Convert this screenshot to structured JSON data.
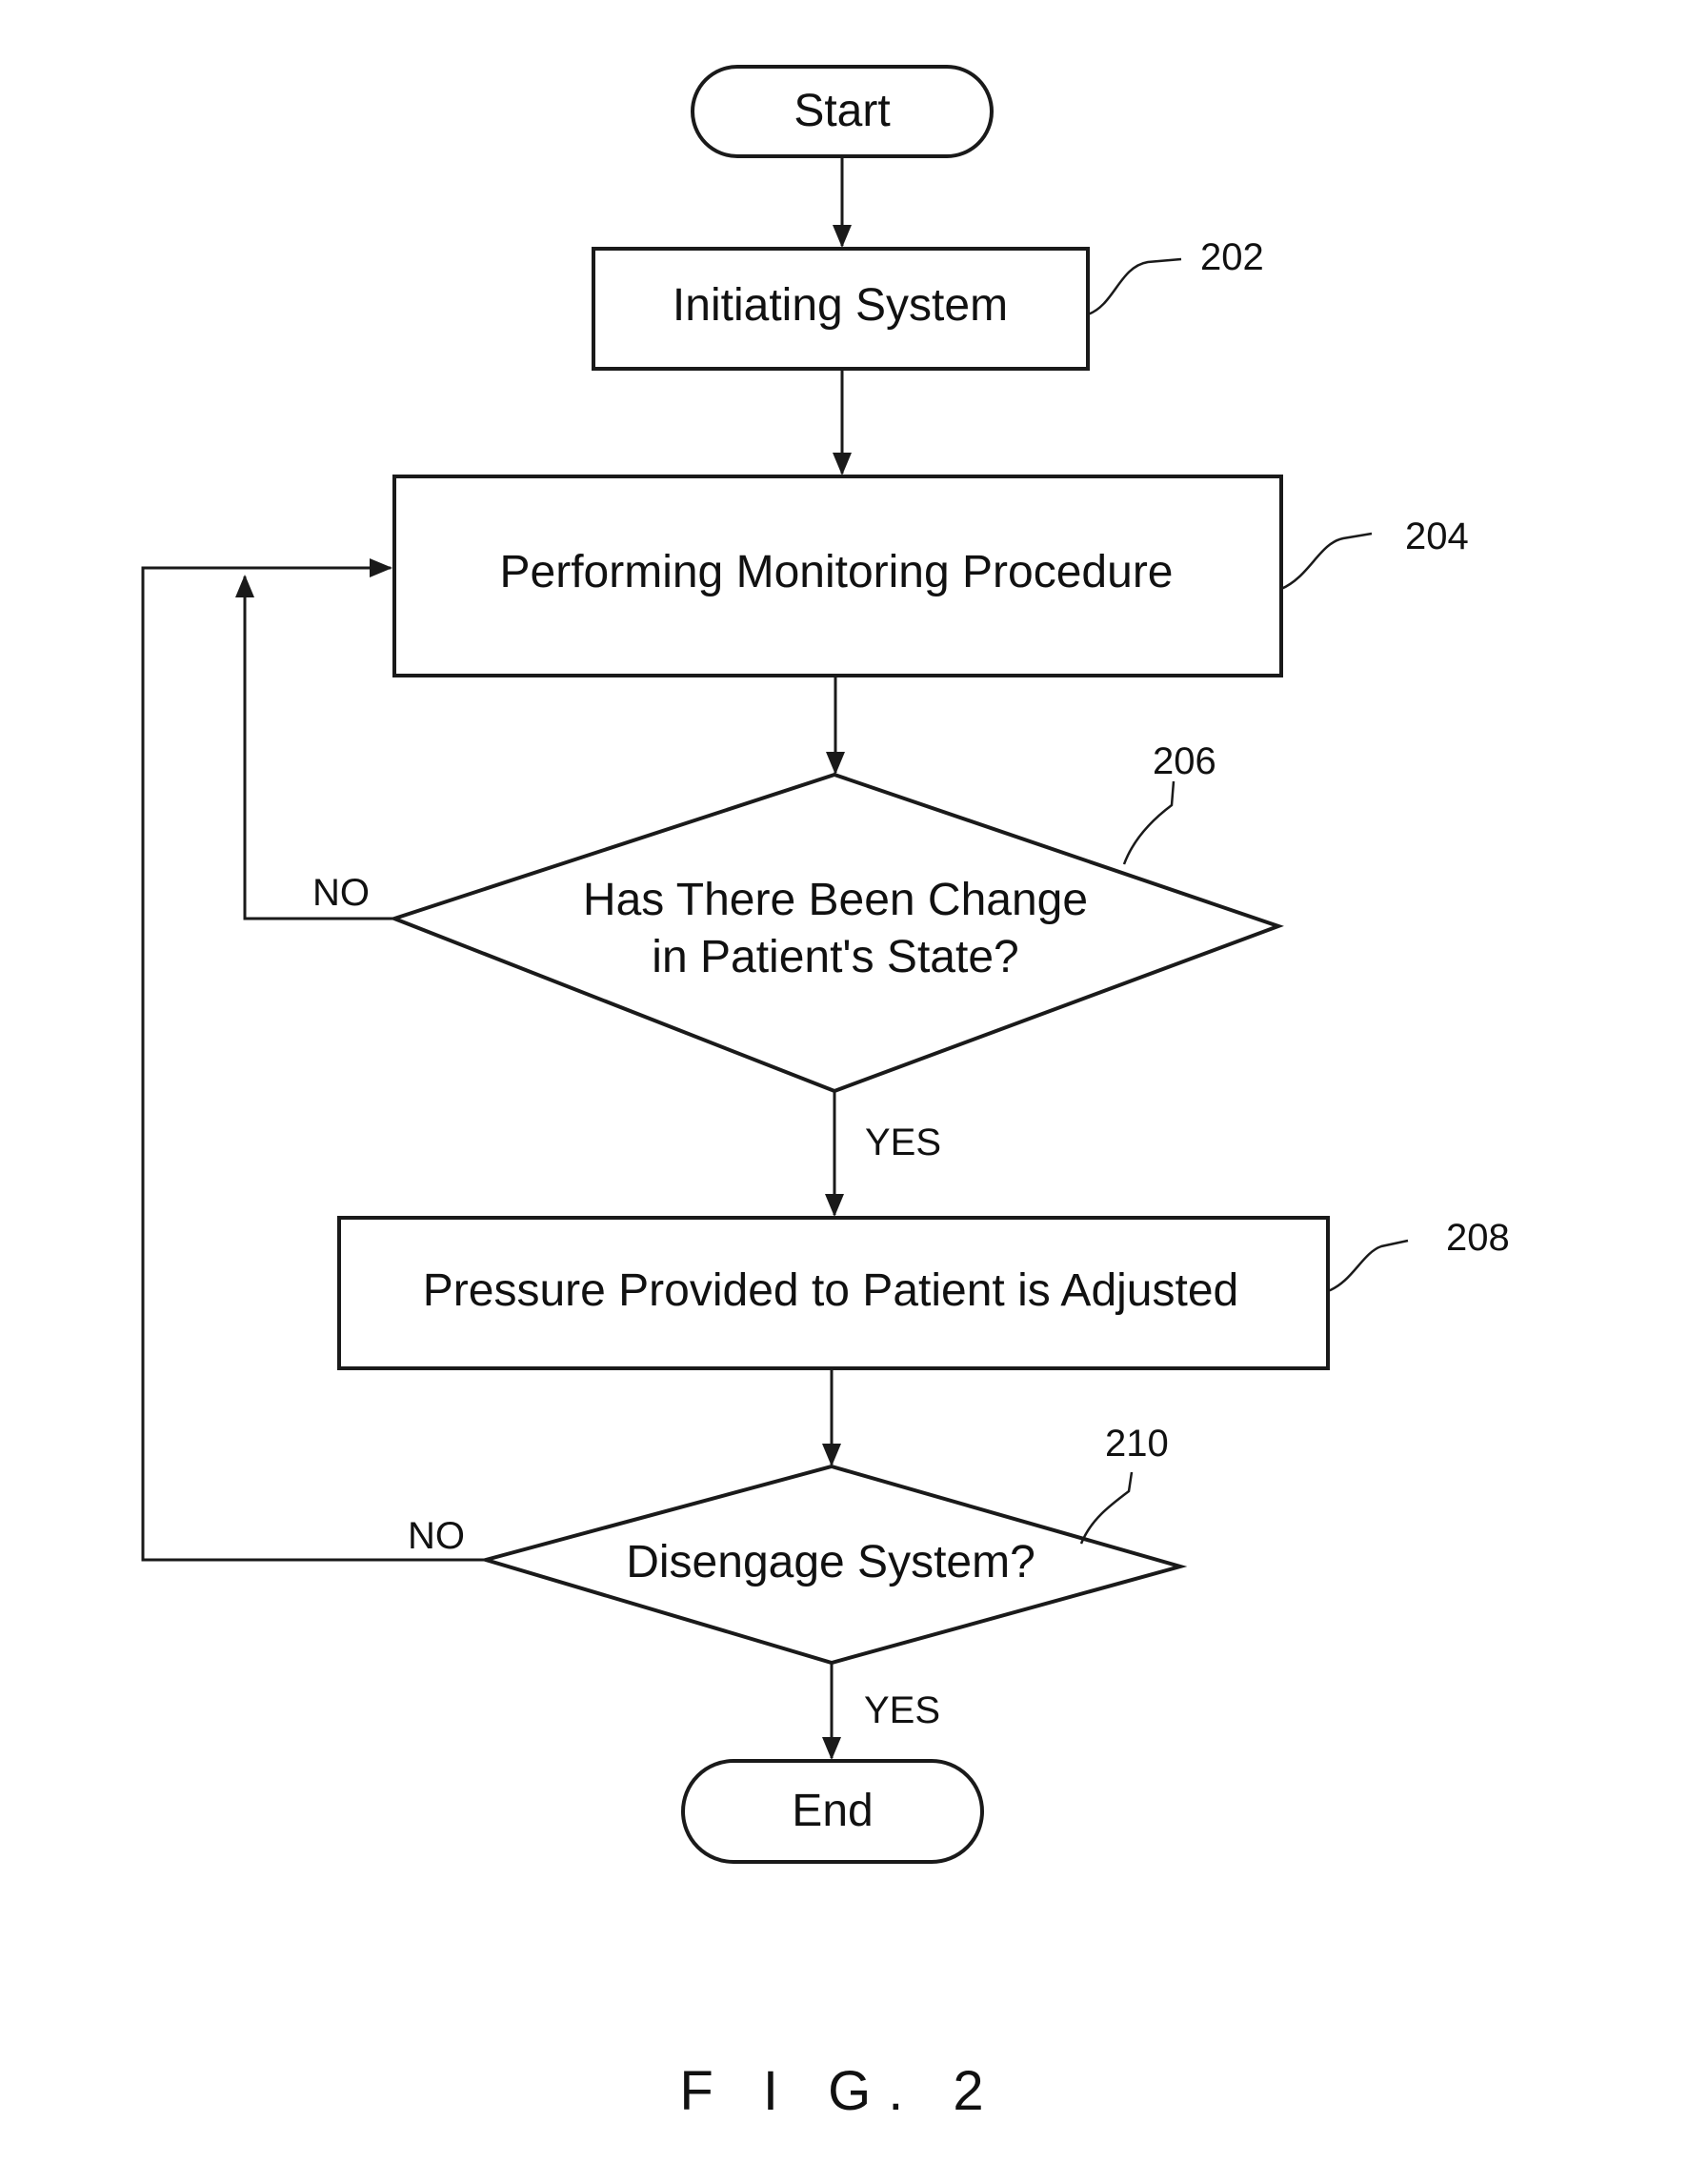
{
  "figure": {
    "caption": "F I G. 2",
    "nodes": {
      "start": {
        "label": "Start"
      },
      "initiating": {
        "label": "Initiating System",
        "ref": "202"
      },
      "monitoring": {
        "label": "Performing Monitoring Procedure",
        "ref": "204"
      },
      "decision_change": {
        "line1": "Has There Been Change",
        "line2": "in Patient's State?",
        "ref": "206"
      },
      "adjust": {
        "label": "Pressure Provided to Patient is Adjusted",
        "ref": "208"
      },
      "decision_disengage": {
        "label": "Disengage System?",
        "ref": "210"
      },
      "end": {
        "label": "End"
      }
    },
    "edge_labels": {
      "change_no": "NO",
      "change_yes": "YES",
      "disengage_no": "NO",
      "disengage_yes": "YES"
    }
  }
}
